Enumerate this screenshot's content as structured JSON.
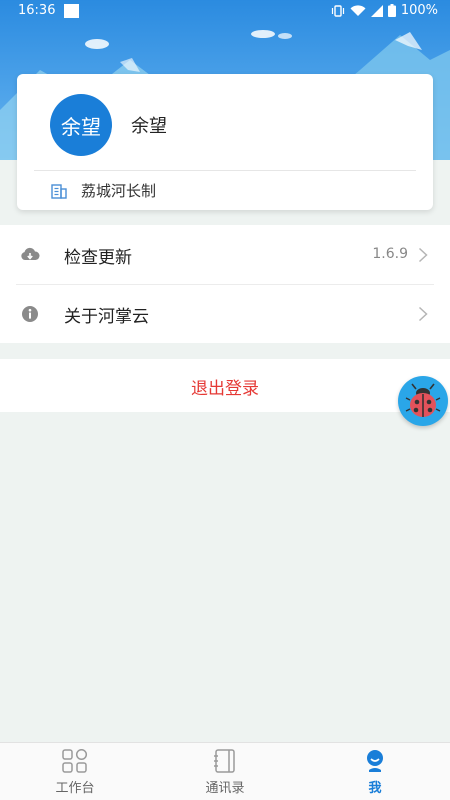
{
  "status_bar": {
    "time": "16:36",
    "battery": "100%"
  },
  "profile": {
    "avatar_text": "余望",
    "name": "余望",
    "organization": "荔城河长制"
  },
  "menu": [
    {
      "icon": "cloud-download-icon",
      "label": "检查更新",
      "value": "1.6.9"
    },
    {
      "icon": "info-icon",
      "label": "关于河掌云",
      "value": ""
    }
  ],
  "logout": {
    "label": "退出登录"
  },
  "colors": {
    "primary": "#1a7ed8",
    "logout": "#e53935",
    "header": "#2b8be0",
    "fab": "#2aa6e8"
  },
  "tabs": [
    {
      "icon": "workbench-icon",
      "label": "工作台",
      "active": false
    },
    {
      "icon": "contacts-icon",
      "label": "通讯录",
      "active": false
    },
    {
      "icon": "profile-icon",
      "label": "我",
      "active": true
    }
  ]
}
